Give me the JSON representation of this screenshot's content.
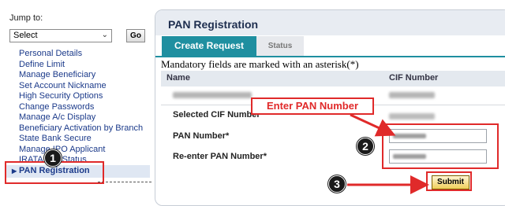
{
  "sidebar": {
    "jump_label": "Jump to:",
    "select_value": "Select",
    "go_label": "Go",
    "menu_items": [
      "Personal Details",
      "Define Limit",
      "Manage Beneficiary",
      "Set Account Nickname",
      "High Security Options",
      "Change Passwords",
      "Manage A/c Display",
      "Beneficiary Activation by Branch",
      "State Bank Secure",
      "Manage IPO Applicant",
      "IRATA Info Status"
    ],
    "active_item": "PAN Registration"
  },
  "panel": {
    "title": "PAN Registration",
    "tabs": [
      {
        "label": "Create Request",
        "active": true
      },
      {
        "label": "Status",
        "active": false
      }
    ],
    "mandatory_note": "Mandatory fields are marked with an asterisk(*)",
    "columns": {
      "name": "Name",
      "cif": "CIF Number"
    },
    "form": {
      "selected_cif_label": "Selected CIF Number",
      "pan_label": "PAN Number*",
      "reenter_pan_label": "Re-enter PAN Number*",
      "submit_label": "Submit"
    }
  },
  "annotations": {
    "callout_text": "Enter PAN Number",
    "steps": [
      "1",
      "2",
      "3"
    ]
  },
  "colors": {
    "tab_active": "#1f8fa0",
    "annotation_red": "#e02a2a",
    "submit_gold": "#f0cf5a",
    "menu_link": "#1b3a8a"
  },
  "icons": {
    "select_chevron": "chevron-down-icon",
    "active_menu_marker": "triangle-right-icon"
  }
}
